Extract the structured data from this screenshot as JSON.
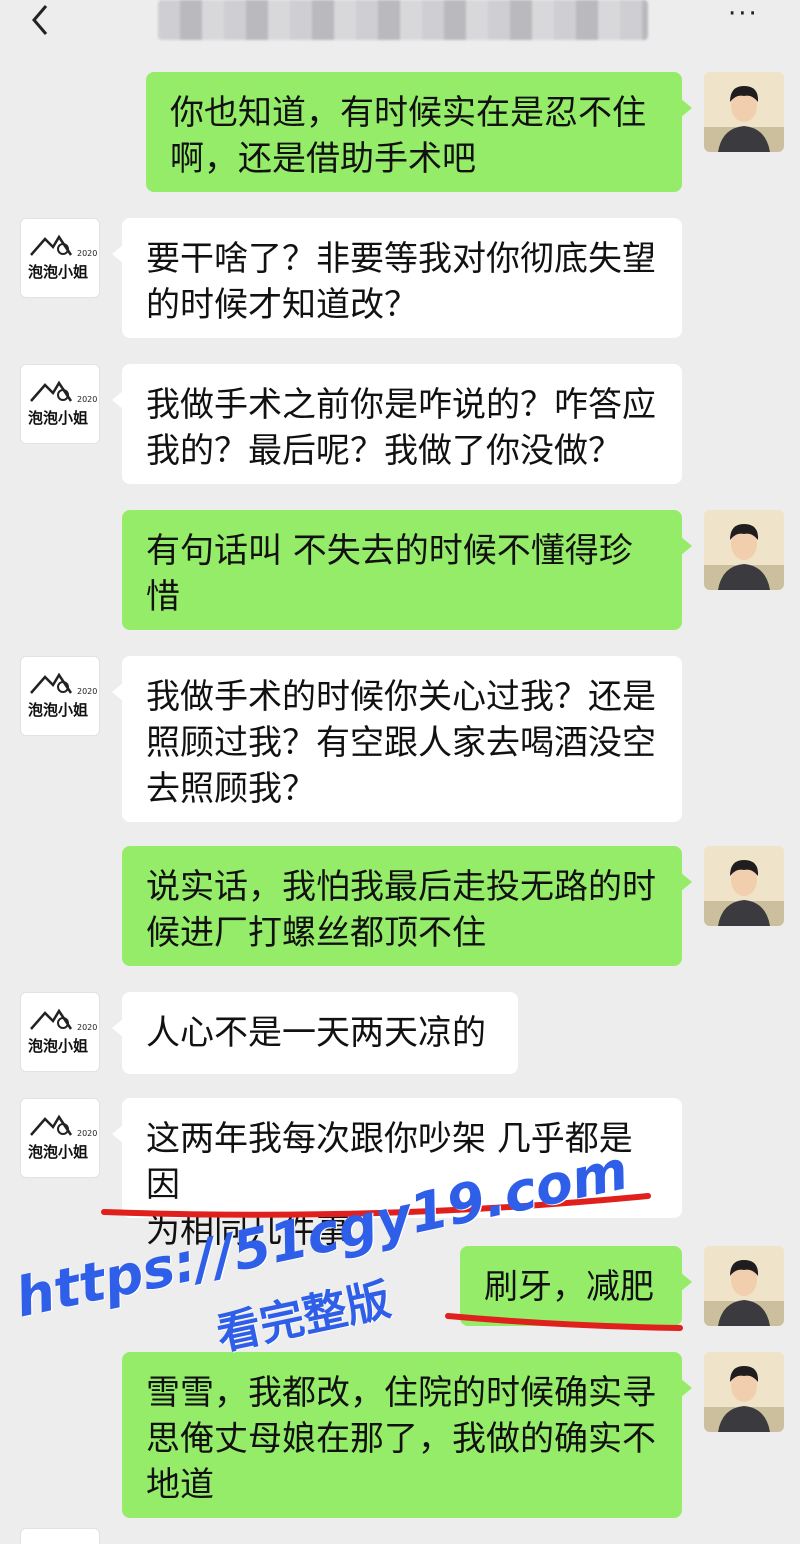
{
  "header": {
    "back_icon": "chevron-left-icon",
    "more_label": "···"
  },
  "colors": {
    "self_bubble": "#95ec69",
    "other_bubble": "#ffffff",
    "background": "#ededed",
    "underline": "#e0201c",
    "watermark": "#2f5fe8"
  },
  "other_avatar_text": "泡泡小姐",
  "messages": [
    {
      "from": "self",
      "text": "你也知道，有时候实在是忍不住\n啊，还是借助手术吧"
    },
    {
      "from": "other",
      "text": "要干啥了？非要等我对你彻底失望\n的时候才知道改？"
    },
    {
      "from": "other",
      "text": "我做手术之前你是咋说的？咋答应\n我的？最后呢？我做了你没做？"
    },
    {
      "from": "self",
      "text": "有句话叫  不失去的时候不懂得珍\n惜"
    },
    {
      "from": "other",
      "text": "我做手术的时候你关心过我？还是\n照顾过我？有空跟人家去喝酒没空\n去照顾我？"
    },
    {
      "from": "self",
      "text": "说实话，我怕我最后走投无路的时\n候进厂打螺丝都顶不住"
    },
    {
      "from": "other",
      "text": "人心不是一天两天凉的"
    },
    {
      "from": "other",
      "text": "这两年我每次跟你吵架 几乎都是因\n为相同几件事"
    },
    {
      "from": "self",
      "text": "刷牙，减肥"
    },
    {
      "from": "self",
      "text": "雪雪，我都改，住院的时候确实寻\n思俺丈母娘在那了，我做的确实不\n地道"
    }
  ],
  "watermark": {
    "url": "https://51cgy19.com",
    "cta": "看完整版"
  }
}
